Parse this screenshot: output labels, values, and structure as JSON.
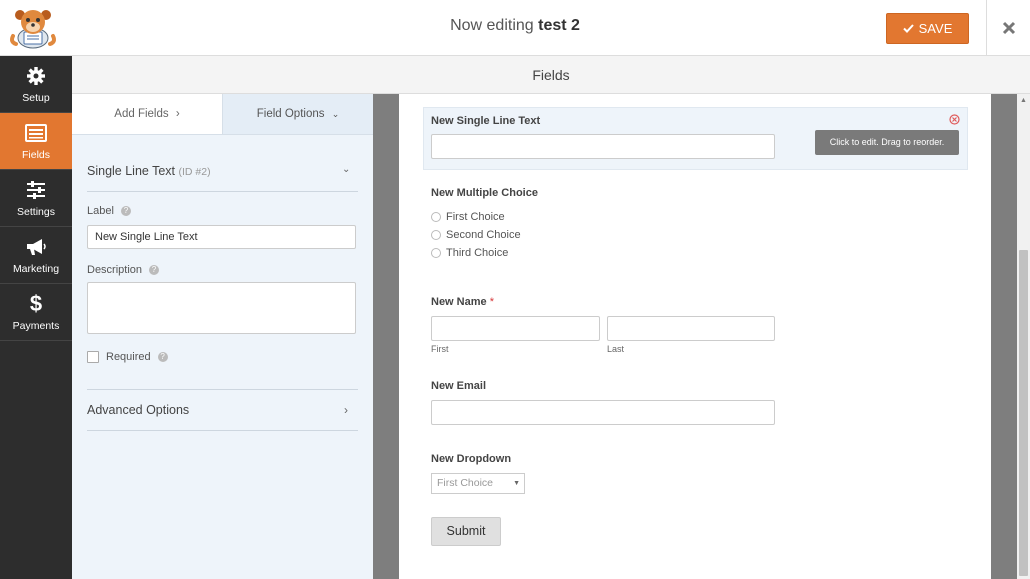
{
  "header": {
    "title_prefix": "Now editing",
    "form_name": "test 2",
    "save_label": "SAVE",
    "accent_color": "#e27730"
  },
  "sidebar": {
    "items": [
      {
        "label": "Setup",
        "icon": "gear-icon"
      },
      {
        "label": "Fields",
        "icon": "fields-list-icon",
        "active": true
      },
      {
        "label": "Settings",
        "icon": "sliders-icon"
      },
      {
        "label": "Marketing",
        "icon": "megaphone-icon"
      },
      {
        "label": "Payments",
        "icon": "dollar-icon"
      }
    ]
  },
  "section_title": "Fields",
  "panel": {
    "tab_add": "Add Fields",
    "tab_options": "Field Options",
    "field_type": "Single Line Text",
    "field_id": "(ID #2)",
    "label_caption": "Label",
    "label_value": "New Single Line Text",
    "description_caption": "Description",
    "description_value": "",
    "required_caption": "Required",
    "required_checked": false,
    "advanced_caption": "Advanced Options"
  },
  "preview": {
    "tooltip": "Click to edit. Drag to reorder.",
    "single_line_label": "New Single Line Text",
    "multiple_choice_label": "New Multiple Choice",
    "choices": [
      "First Choice",
      "Second Choice",
      "Third Choice"
    ],
    "name_label": "New Name",
    "required_marker": "*",
    "name_first": "First",
    "name_last": "Last",
    "email_label": "New Email",
    "dropdown_label": "New Dropdown",
    "dropdown_value": "First Choice",
    "submit_label": "Submit"
  }
}
